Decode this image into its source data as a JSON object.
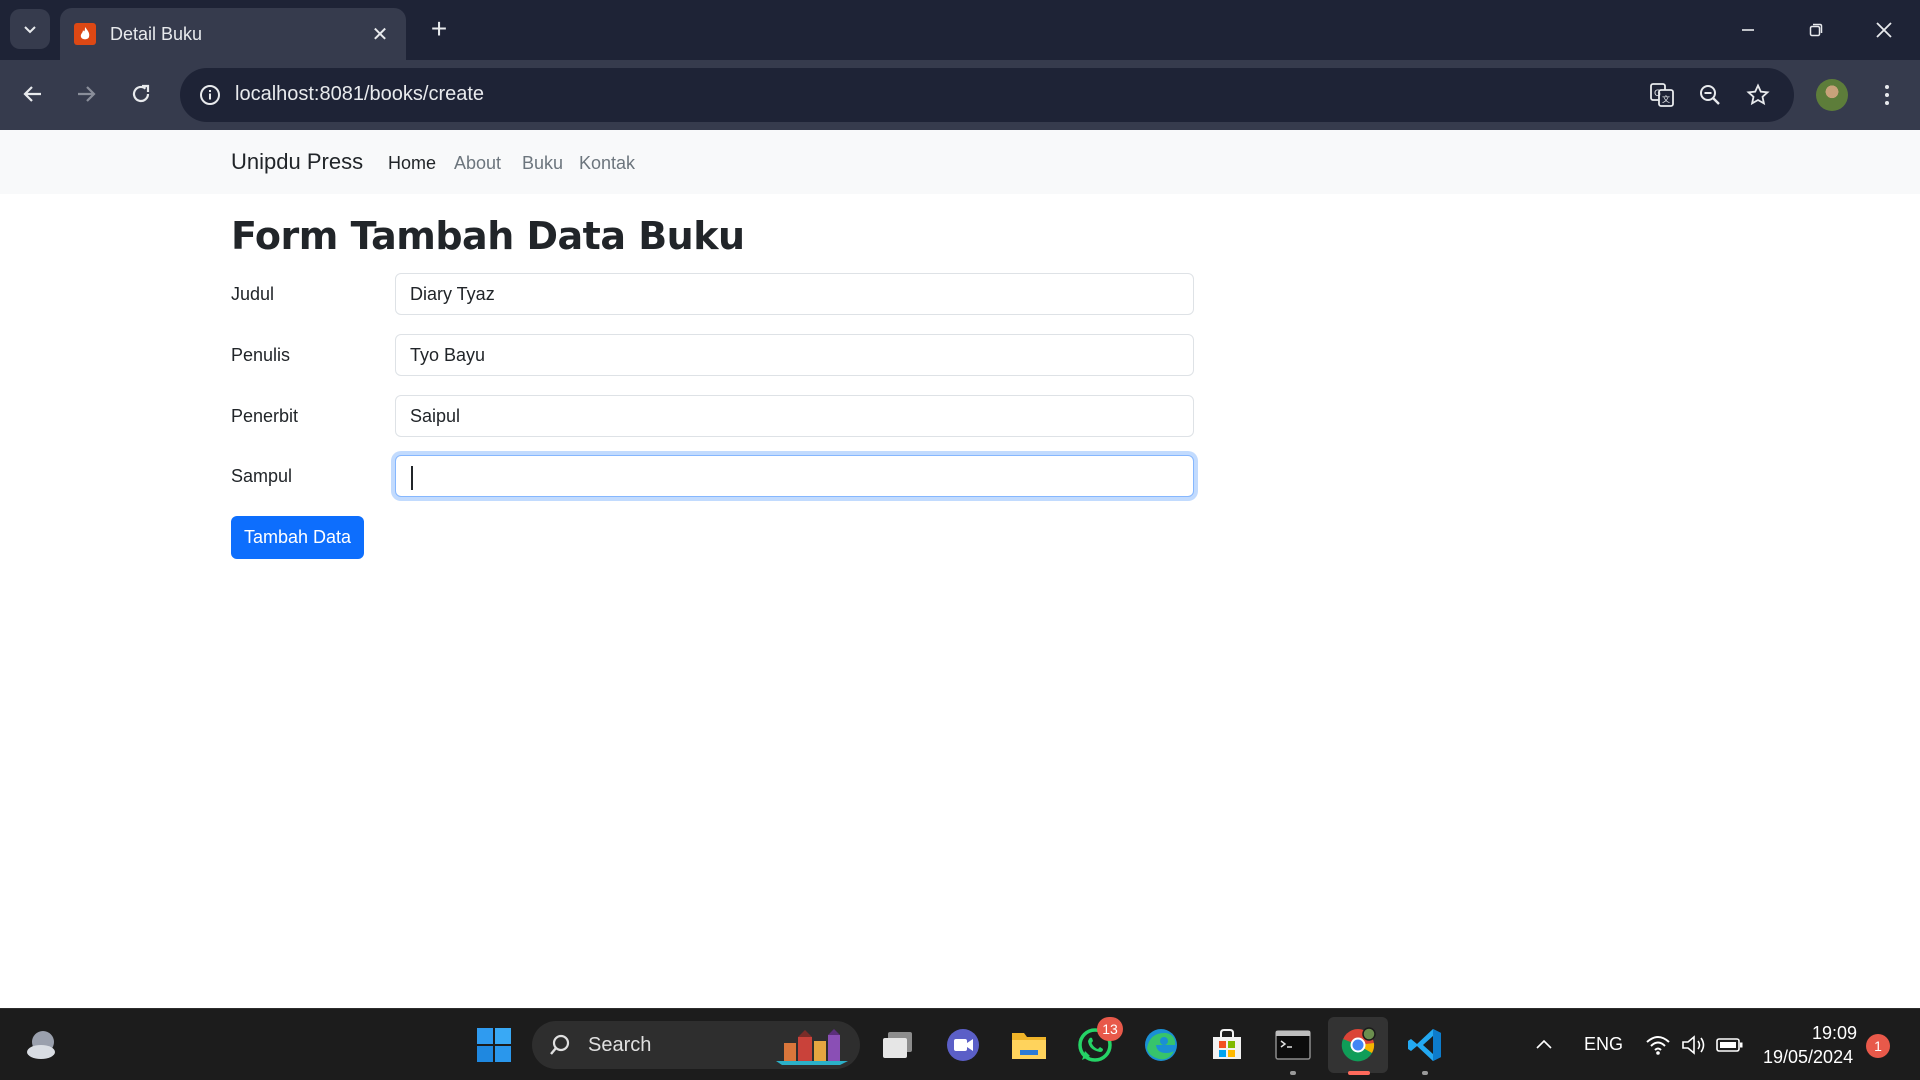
{
  "browser": {
    "tab_title": "Detail Buku",
    "url": "localhost:8081/books/create"
  },
  "page": {
    "brand": "Unipdu Press",
    "nav": [
      "Home",
      "About",
      "Buku",
      "Kontak"
    ],
    "title": "Form Tambah Data Buku",
    "fields": [
      {
        "label": "Judul",
        "value": "Diary Tyaz"
      },
      {
        "label": "Penulis",
        "value": "Tyo Bayu"
      },
      {
        "label": "Penerbit",
        "value": "Saipul"
      },
      {
        "label": "Sampul",
        "value": ""
      }
    ],
    "submit_label": "Tambah Data"
  },
  "taskbar": {
    "search_label": "Search",
    "whatsapp_badge": "13",
    "language": "ENG",
    "time": "19:09",
    "date": "19/05/2024",
    "notification_count": "1"
  },
  "colors": {
    "primary": "#0d6efd",
    "chrome_dark": "#1e2336",
    "chrome_mid": "#363b4d"
  }
}
